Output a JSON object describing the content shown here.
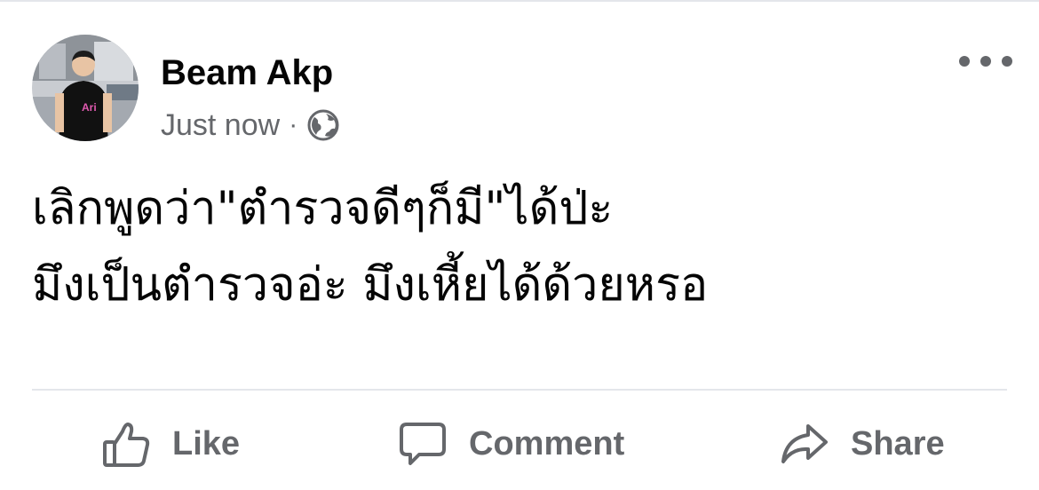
{
  "post": {
    "author": "Beam Akp",
    "timestamp": "Just now",
    "separator": "·",
    "audience_icon": "globe-icon",
    "more_icon": "more-options-icon",
    "text_lines": [
      "เลิกพูดว่า\"ตำรวจดีๆก็มี\"ได้ป่ะ",
      "มึงเป็นตำรวจอ่ะ มึงเหี้ยได้ด้วยหรอ"
    ]
  },
  "actions": {
    "like": {
      "label": "Like",
      "icon": "thumbs-up-icon"
    },
    "comment": {
      "label": "Comment",
      "icon": "comment-icon"
    },
    "share": {
      "label": "Share",
      "icon": "share-icon"
    }
  },
  "colors": {
    "text_primary": "#050505",
    "text_secondary": "#65676b",
    "divider": "#e4e6eb",
    "background": "#ffffff"
  }
}
